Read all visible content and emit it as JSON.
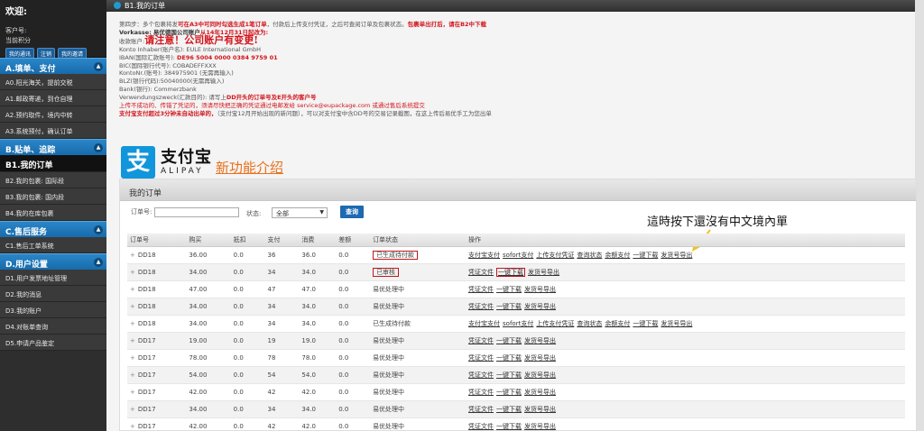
{
  "sidebar": {
    "welcome": "欢迎:",
    "customer_label": "客户号:",
    "points_label": "当前积分",
    "buttons": [
      "我的通讯",
      "注销",
      "我的邀请"
    ],
    "sections": [
      {
        "label": "A.填单、支付",
        "items": [
          "A0.阳光海关，提前交税",
          "A1.邮政寄递，到仓自理",
          "A2.预约取件，境内中转",
          "A3.系统预付，确认订单"
        ]
      },
      {
        "label": "B.贴单、追踪",
        "items": [
          "B1.我的订单",
          "B2.我的包裹: 国际段",
          "B3.我的包裹: 国内段",
          "B4.我的在库包裹"
        ]
      },
      {
        "label": "C.售后服务",
        "items": [
          "C1.售后工单系统"
        ]
      },
      {
        "label": "D.用户设置",
        "items": [
          "D1.用户发票地址管理",
          "D2.我的消息",
          "D3.我的账户",
          "D4.对账单查询",
          "D5.申请产品鉴定"
        ]
      }
    ],
    "active_item": "B1.我的订单"
  },
  "topbar": {
    "title": "B1.我的订单"
  },
  "info": {
    "l1_a": "第四步：多个包裹将发",
    "l1_b": "可在A3中可同时勾选生成1笔订单",
    "l1_c": "，付款后上传支付凭证，之后可查阅订单及包裹状态。",
    "l1_d": "包裹单出打后，请在B2中下载",
    "l2_a": "Vorkasse:",
    "l2_b": "易优德国公司账户",
    "l2_c": "从14年12月31日起改为:",
    "l3_a": "收款账户:",
    "l3_b": "请注意！公司账户有变更!",
    "l4": "Konto Inhaber(账户名): EULE International GmbH",
    "l5_a": "IBAN(国际汇款账号):",
    "l5_b": "DE96 5004 0000 0384 9759 01",
    "l6": "BIC(国际银行代号): COBADEFFXXX",
    "l7": "KontoNr.(账号): 384975901 (无需再输入)",
    "l8": "BLZ(银行代码):50040000(无需再输入)",
    "l9": "Bank(银行): Commerzbank",
    "l10_a": "Verwendungszweck(汇款目的): 请写上",
    "l10_b": "DD开头的订单号及E开头的客户号",
    "l11": "上传不成功的、传错了凭证的，须请尽快把正确的凭证通过电邮发给 service@eupackage.com 或通过售后系统提交",
    "l12_a": "支付宝支付超过3分钟未自动出单的，",
    "l12_b": "（支付宝12月开始出现的新问题），可以对支付宝中含DD号的交易记录截图，在这上传后易优手工为您出单"
  },
  "alipay": {
    "logo_glyph": "支",
    "cn": "支付宝",
    "en": "ALIPAY",
    "new_feature": "新功能介绍"
  },
  "panel": {
    "title": "我的订单",
    "filter": {
      "order_label": "订单号:",
      "status_label": "状态:",
      "status_value": "全部",
      "search_button": "查询"
    },
    "annotation": "這時按下還沒有中文境內單",
    "columns": [
      "订单号",
      "购买",
      "抵扣",
      "支付",
      "消费",
      "差额",
      "订单状态",
      "操作"
    ],
    "rows": [
      {
        "id": "DD18",
        "buy": "36.00",
        "deduct": "0.0",
        "pay": "36",
        "consume": "36.0",
        "diff": "0.0",
        "status": "已生成待付款",
        "status_boxed": true,
        "actions": [
          "支付宝支付",
          "sofort支付",
          "上传支付凭证",
          "查询状态",
          "余额支付",
          "一键下载",
          "发货号导出"
        ],
        "boxed_action": -1
      },
      {
        "id": "DD18",
        "buy": "34.00",
        "deduct": "0.0",
        "pay": "34",
        "consume": "34.0",
        "diff": "0.0",
        "status": "已审核",
        "status_boxed": true,
        "actions": [
          "凭证文件",
          "一键下载",
          "发货号导出"
        ],
        "boxed_action": 1
      },
      {
        "id": "DD18",
        "buy": "47.00",
        "deduct": "0.0",
        "pay": "47",
        "consume": "47.0",
        "diff": "0.0",
        "status": "易优处理中",
        "status_boxed": false,
        "actions": [
          "凭证文件",
          "一键下载",
          "发货号导出"
        ],
        "boxed_action": -1
      },
      {
        "id": "DD18",
        "buy": "34.00",
        "deduct": "0.0",
        "pay": "34",
        "consume": "34.0",
        "diff": "0.0",
        "status": "易优处理中",
        "status_boxed": false,
        "actions": [
          "凭证文件",
          "一键下载",
          "发货号导出"
        ],
        "boxed_action": -1
      },
      {
        "id": "DD18",
        "buy": "34.00",
        "deduct": "0.0",
        "pay": "34",
        "consume": "34.0",
        "diff": "0.0",
        "status": "已生成待付款",
        "status_boxed": false,
        "actions": [
          "支付宝支付",
          "sofort支付",
          "上传支付凭证",
          "查询状态",
          "余额支付",
          "一键下载",
          "发货号导出"
        ],
        "boxed_action": -1
      },
      {
        "id": "DD17",
        "buy": "19.00",
        "deduct": "0.0",
        "pay": "19",
        "consume": "19.0",
        "diff": "0.0",
        "status": "易优处理中",
        "status_boxed": false,
        "actions": [
          "凭证文件",
          "一键下载",
          "发货号导出"
        ],
        "boxed_action": -1
      },
      {
        "id": "DD17",
        "buy": "78.00",
        "deduct": "0.0",
        "pay": "78",
        "consume": "78.0",
        "diff": "0.0",
        "status": "易优处理中",
        "status_boxed": false,
        "actions": [
          "凭证文件",
          "一键下载",
          "发货号导出"
        ],
        "boxed_action": -1
      },
      {
        "id": "DD17",
        "buy": "54.00",
        "deduct": "0.0",
        "pay": "54",
        "consume": "54.0",
        "diff": "0.0",
        "status": "易优处理中",
        "status_boxed": false,
        "actions": [
          "凭证文件",
          "一键下载",
          "发货号导出"
        ],
        "boxed_action": -1
      },
      {
        "id": "DD17",
        "buy": "42.00",
        "deduct": "0.0",
        "pay": "42",
        "consume": "42.0",
        "diff": "0.0",
        "status": "易优处理中",
        "status_boxed": false,
        "actions": [
          "凭证文件",
          "一键下载",
          "发货号导出"
        ],
        "boxed_action": -1
      },
      {
        "id": "DD17",
        "buy": "34.00",
        "deduct": "0.0",
        "pay": "34",
        "consume": "34.0",
        "diff": "0.0",
        "status": "易优处理中",
        "status_boxed": false,
        "actions": [
          "凭证文件",
          "一键下载",
          "发货号导出"
        ],
        "boxed_action": -1
      },
      {
        "id": "DD17",
        "buy": "42.00",
        "deduct": "0.0",
        "pay": "42",
        "consume": "42.0",
        "diff": "0.0",
        "status": "易优处理中",
        "status_boxed": false,
        "actions": [
          "凭证文件",
          "一键下载",
          "发货号导出"
        ],
        "boxed_action": -1
      }
    ]
  }
}
